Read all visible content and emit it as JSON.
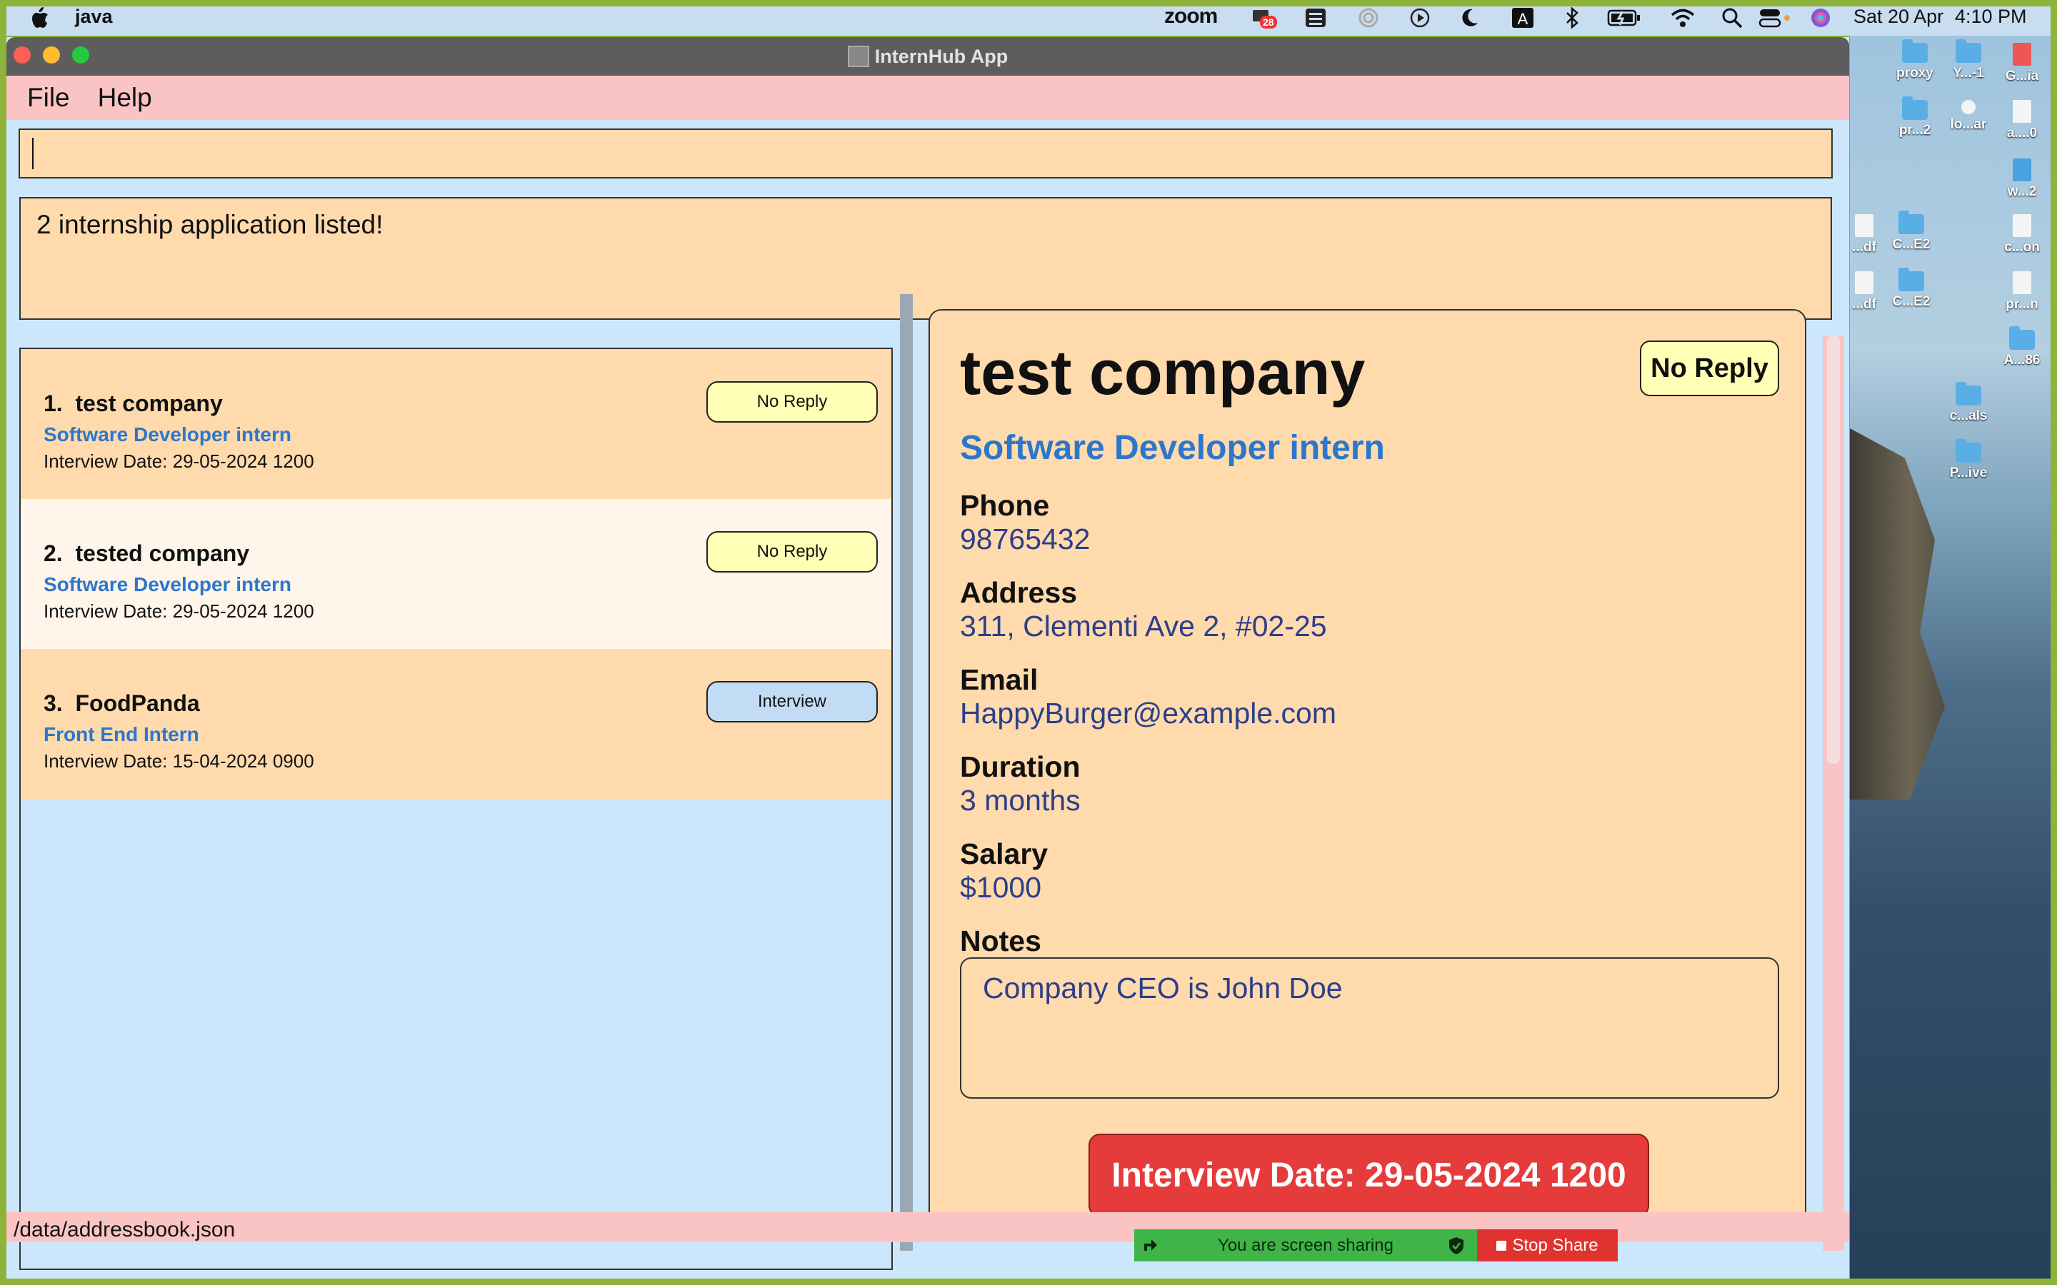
{
  "menubar": {
    "app_name": "java",
    "date": "Sat 20 Apr",
    "time": "4:10 PM",
    "zoom_label": "zoom",
    "zoom_badge": "28"
  },
  "desktop_icons": [
    "proxy",
    "Y...-1",
    "G...ia",
    "pr...2",
    "lo...ar",
    "a....0",
    "w...2",
    "...df",
    "C...E2",
    "c...on",
    "...df",
    "C...E2",
    "pr...n",
    "A...86",
    "c...als",
    "P...ive"
  ],
  "window": {
    "title": "InternHub App"
  },
  "app_menu": {
    "file": "File",
    "help": "Help"
  },
  "command": {
    "value": ""
  },
  "result": {
    "text": "2 internship application listed!"
  },
  "list": {
    "items": [
      {
        "index": "1.",
        "company": "test company",
        "role": "Software Developer intern",
        "date": "Interview Date: 29-05-2024 1200",
        "status": "No Reply"
      },
      {
        "index": "2.",
        "company": "tested company",
        "role": "Software Developer intern",
        "date": "Interview Date: 29-05-2024 1200",
        "status": "No Reply"
      },
      {
        "index": "3.",
        "company": "FoodPanda",
        "role": "Front End Intern",
        "date": "Interview Date: 15-04-2024 0900",
        "status": "Interview"
      }
    ]
  },
  "detail": {
    "company": "test company",
    "status": "No Reply",
    "role": "Software Developer intern",
    "phone_label": "Phone",
    "phone": "98765432",
    "address_label": "Address",
    "address": "311, Clementi Ave 2, #02-25",
    "email_label": "Email",
    "email": "HappyBurger@example.com",
    "duration_label": "Duration",
    "duration": "3 months",
    "salary_label": "Salary",
    "salary": "$1000",
    "notes_label": "Notes",
    "notes": "Company CEO is John Doe",
    "interview_date": "Interview Date: 29-05-2024 1200"
  },
  "status_bar": {
    "path": "/data/addressbook.json"
  },
  "screen_share": {
    "message": "You are screen sharing",
    "stop": "Stop Share"
  },
  "colors": {
    "panel": "#ffdaad",
    "menu": "#fbc4c4",
    "background": "#cce7fb",
    "role": "#2c77cc",
    "value": "#2b3e8a",
    "no_reply": "#ffffb5",
    "interview": "#c2dcf6",
    "date_button": "#e53b3b"
  }
}
